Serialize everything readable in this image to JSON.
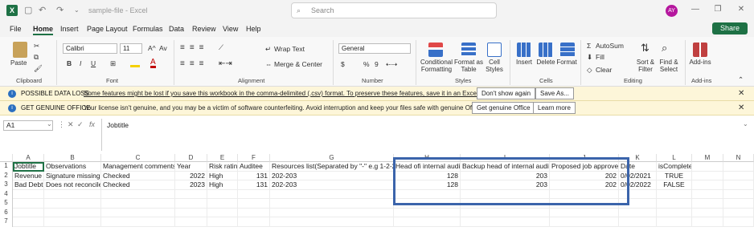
{
  "window": {
    "app_icon": "excel-logo",
    "file_title": "sample-file - Excel",
    "search_placeholder": "Search",
    "avatar_initials": "AY",
    "share_label": "Share"
  },
  "menu": [
    "File",
    "Home",
    "Insert",
    "Page Layout",
    "Formulas",
    "Data",
    "Review",
    "View",
    "Help"
  ],
  "ribbon": {
    "clipboard": {
      "paste": "Paste",
      "group": "Clipboard"
    },
    "font": {
      "name": "Calibri",
      "size": "11",
      "bold": "B",
      "italic": "I",
      "underline": "U",
      "grow": "A^",
      "shrink": "Av",
      "group": "Font"
    },
    "alignment": {
      "wrap": "Wrap Text",
      "merge": "Merge & Center",
      "group": "Alignment"
    },
    "number": {
      "format": "General",
      "currency": "$",
      "percent": "%",
      "comma": "9",
      "group": "Number"
    },
    "styles": {
      "conditional": "Conditional Formatting",
      "format_table": "Format as Table",
      "cell_styles": "Cell Styles",
      "group": "Styles"
    },
    "cells": {
      "insert": "Insert",
      "delete": "Delete",
      "format": "Format",
      "group": "Cells"
    },
    "editing": {
      "autosum": "AutoSum",
      "fill": "Fill",
      "clear": "Clear",
      "sort": "Sort & Filter",
      "find": "Find & Select",
      "group": "Editing"
    },
    "addins": {
      "label": "Add-ins",
      "group": "Add-ins"
    }
  },
  "messages": [
    {
      "label": "POSSIBLE DATA LOSS",
      "text": "Some features might be lost if you save this workbook in the comma-delimited (.csv) format. To preserve these features, save it in an Excel file format.",
      "btn1": "Don't show again",
      "btn2": "Save As..."
    },
    {
      "label": "GET GENUINE OFFICE",
      "text": "Your license isn't genuine, and you may be a victim of software counterfeiting. Avoid interruption and keep your files safe with genuine Office today.",
      "btn1": "Get genuine Office",
      "btn2": "Learn more"
    }
  ],
  "formula_bar": {
    "name_box": "A1",
    "fx": "fx",
    "content": "Jobtitle"
  },
  "columns": [
    "A",
    "B",
    "C",
    "D",
    "E",
    "F",
    "G",
    "H",
    "I",
    "J",
    "K",
    "L",
    "M",
    "N"
  ],
  "rows": [
    "1",
    "2",
    "3",
    "4",
    "5",
    "6",
    "7"
  ],
  "sheet": {
    "row1": [
      "Jobtitle",
      "Observations",
      "Management comments",
      "Year",
      "Risk rating",
      "Auditee",
      "Resources list(Separated by \"-\" e.g 1-2-22",
      "Head ofi internal audit",
      "Backup head of internal audit",
      "Proposed job approver",
      "Date",
      "isComplete"
    ],
    "row2": [
      "Revenue",
      "Signature missing",
      "Checked",
      "2022",
      "High",
      "131",
      "202-203",
      "128",
      "203",
      "202",
      "0/02/2021",
      "TRUE"
    ],
    "row3": [
      "Bad Debt",
      "Does not reconcile",
      "Checked",
      "2023",
      "High",
      "131",
      "202-203",
      "128",
      "203",
      "202",
      "0/02/2022",
      "FALSE"
    ]
  },
  "colors": {
    "excel_green": "#1e7145",
    "highlight_box": "#3b64ab",
    "message_bg": "#fdf6d9"
  }
}
